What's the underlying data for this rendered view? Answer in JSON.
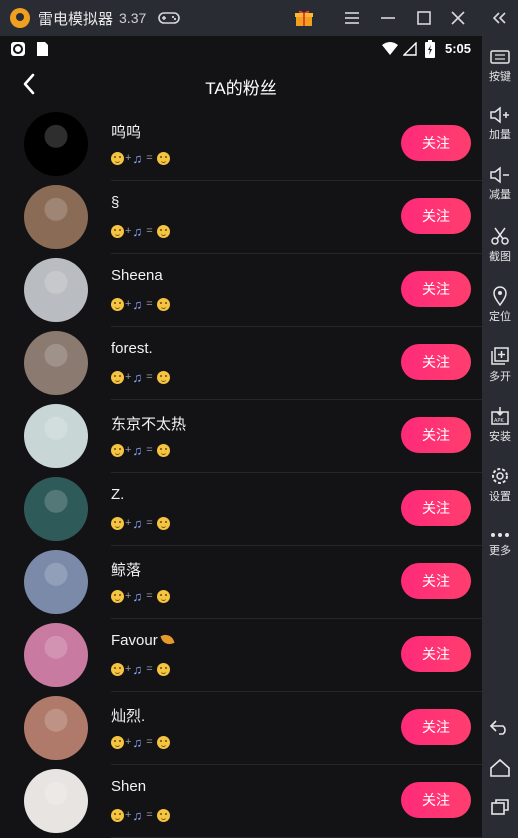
{
  "emulator": {
    "title": "雷电模拟器",
    "version": "3.37",
    "icons": [
      "gamepad-icon",
      "gift-icon",
      "menu-icon",
      "minimize-icon",
      "maximize-icon",
      "close-icon",
      "collapse-sidebar-icon"
    ]
  },
  "sidebar": {
    "items": [
      {
        "label": "按键",
        "icon": "keyboard-icon"
      },
      {
        "label": "加量",
        "icon": "volume-up-icon"
      },
      {
        "label": "减量",
        "icon": "volume-down-icon"
      },
      {
        "label": "截图",
        "icon": "scissors-icon"
      },
      {
        "label": "定位",
        "icon": "location-icon"
      },
      {
        "label": "多开",
        "icon": "multi-instance-icon"
      },
      {
        "label": "安装",
        "icon": "apk-install-icon"
      },
      {
        "label": "设置",
        "icon": "gear-icon"
      },
      {
        "label": "更多",
        "icon": "more-icon"
      }
    ],
    "nav_icons": [
      "back-icon",
      "home-icon",
      "recents-icon"
    ]
  },
  "statusbar": {
    "time": "5:05"
  },
  "header": {
    "title": "TA的粉丝"
  },
  "bio_text": {
    "plus": "+",
    "equals": "="
  },
  "followers": [
    {
      "name": "呜呜",
      "follow_label": "关注",
      "avatar_color": "#000000"
    },
    {
      "name": "§",
      "follow_label": "关注",
      "avatar_color": "#8a6b55"
    },
    {
      "name": "Sheena",
      "follow_label": "关注",
      "avatar_color": "#b9bcc0"
    },
    {
      "name": "forest.",
      "follow_label": "关注",
      "avatar_color": "#8a7a70"
    },
    {
      "name": "东京不太热",
      "follow_label": "关注",
      "avatar_color": "#c8d7d6"
    },
    {
      "name": "Z.",
      "follow_label": "关注",
      "avatar_color": "#2f5a5a"
    },
    {
      "name": "鲸落",
      "follow_label": "关注",
      "avatar_color": "#7a8aa8"
    },
    {
      "name": "Favour",
      "follow_label": "关注",
      "avatar_color": "#c87aa0",
      "badge": "leaf-icon"
    },
    {
      "name": "灿烈.",
      "follow_label": "关注",
      "avatar_color": "#b07a6a"
    },
    {
      "name": "Shen",
      "follow_label": "关注",
      "avatar_color": "#e8e4e2"
    }
  ],
  "colors": {
    "follow_button": "#ff2f76",
    "background": "#131316",
    "chrome": "#2a2c33"
  }
}
